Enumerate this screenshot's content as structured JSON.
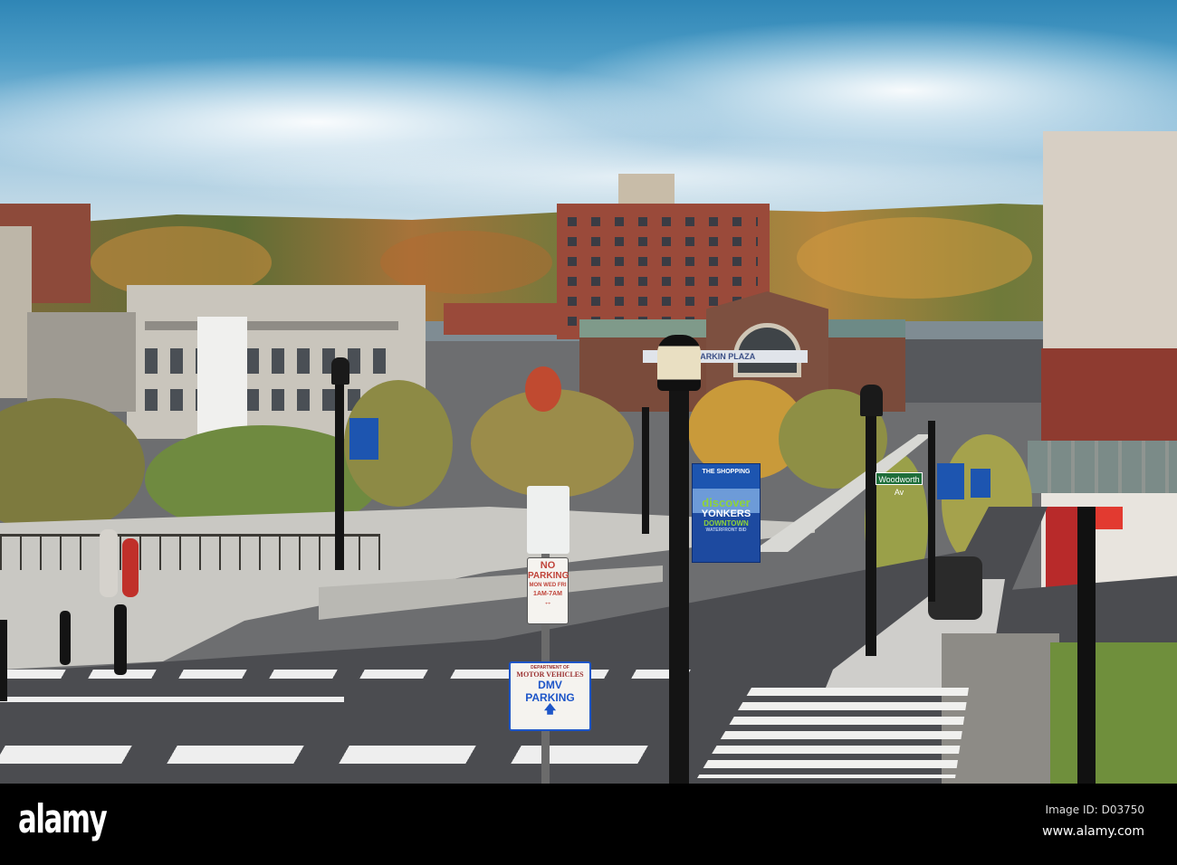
{
  "signs": {
    "no_parking": {
      "line1": "NO",
      "line2": "PARKING",
      "line3": "MON WED FRI",
      "line4": "1AM-7AM"
    },
    "dmv": {
      "line1": "DEPARTMENT OF",
      "line2": "MOTOR VEHICLES",
      "line3": "DMV",
      "line4": "PARKING"
    },
    "banner": {
      "header": "THE SHOPPING",
      "discover": "discover",
      "city": "YONKERS",
      "downtown": "DOWNTOWN",
      "bid": "WATERFRONT BID"
    },
    "street": "Woodworth Av",
    "station_banner": "LARKIN PLAZA"
  },
  "watermark": {
    "logo": "alamy",
    "image_id": "Image ID: D03750",
    "url": "www.alamy.com"
  },
  "colors": {
    "sky": "#3a8fc0",
    "brick": "#9a4a3a",
    "road": "#4b4c50",
    "banner_blue": "#1d55b0"
  }
}
